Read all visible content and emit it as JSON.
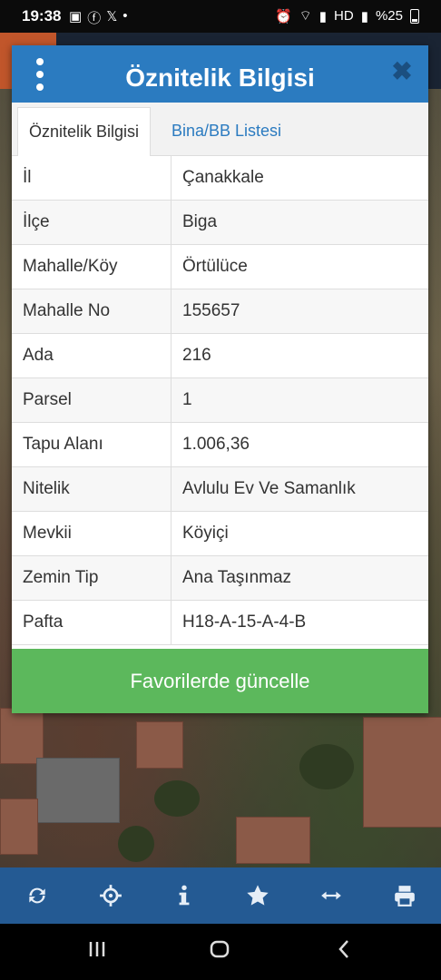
{
  "status_bar": {
    "time": "19:38",
    "battery": "%25",
    "icons": [
      "gallery-icon",
      "facebook-icon",
      "x-icon",
      "dot-icon",
      "alarm-icon",
      "wifi-icon",
      "signal-icon",
      "hd-icon",
      "signal-icon"
    ]
  },
  "dialog": {
    "title": "Öznitelik Bilgisi",
    "tabs": [
      {
        "label": "Öznitelik Bilgisi",
        "active": true
      },
      {
        "label": "Bina/BB Listesi",
        "active": false
      }
    ],
    "rows": [
      {
        "key": "İl",
        "value": "Çanakkale"
      },
      {
        "key": "İlçe",
        "value": "Biga"
      },
      {
        "key": "Mahalle/Köy",
        "value": "Örtülüce"
      },
      {
        "key": "Mahalle No",
        "value": "155657"
      },
      {
        "key": "Ada",
        "value": "216"
      },
      {
        "key": "Parsel",
        "value": "1"
      },
      {
        "key": "Tapu Alanı",
        "value": "1.006,36"
      },
      {
        "key": "Nitelik",
        "value": "Avlulu Ev Ve Samanlık"
      },
      {
        "key": "Mevkii",
        "value": "Köyiçi"
      },
      {
        "key": "Zemin Tip",
        "value": "Ana Taşınmaz"
      },
      {
        "key": "Pafta",
        "value": "H18-A-15-A-4-B"
      }
    ],
    "favorite_button": "Favorilerde güncelle"
  },
  "toolbar": [
    "refresh-icon",
    "locate-icon",
    "info-icon",
    "star-icon",
    "measure-icon",
    "print-icon"
  ],
  "colors": {
    "header": "#2b7bc0",
    "button": "#5cb85c",
    "toolbar": "#245a93"
  }
}
